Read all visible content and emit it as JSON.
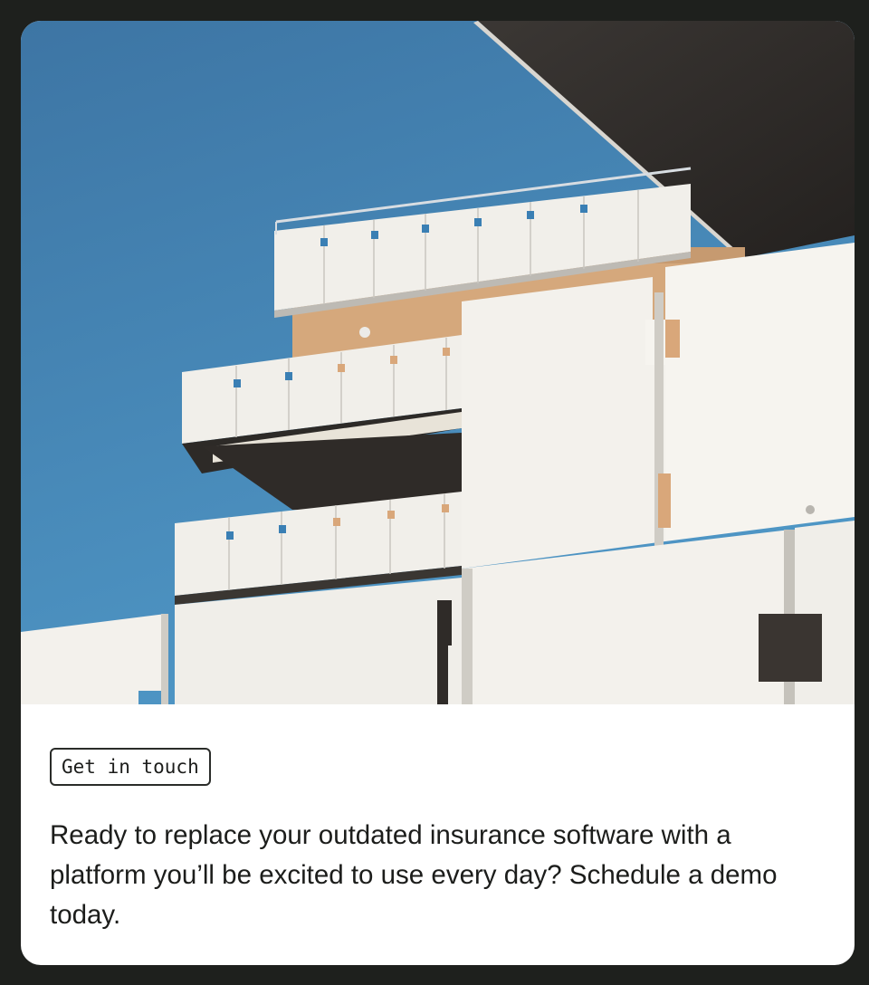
{
  "card": {
    "image": {
      "subject": "modern-white-building-balconies",
      "sky_color": "#3f7fae",
      "facade_color": "#f1efea",
      "accent_blue": "#3a7fb4",
      "accent_tan": "#d9a77a"
    },
    "tag_label": "Get in touch",
    "body_text": "Ready to replace your outdated insurance software with a platform you’ll be excited to use every day? Schedule a demo today."
  },
  "colors": {
    "page_background": "#1e201d",
    "card_background": "#ffffff",
    "text": "#1c1d1b"
  }
}
